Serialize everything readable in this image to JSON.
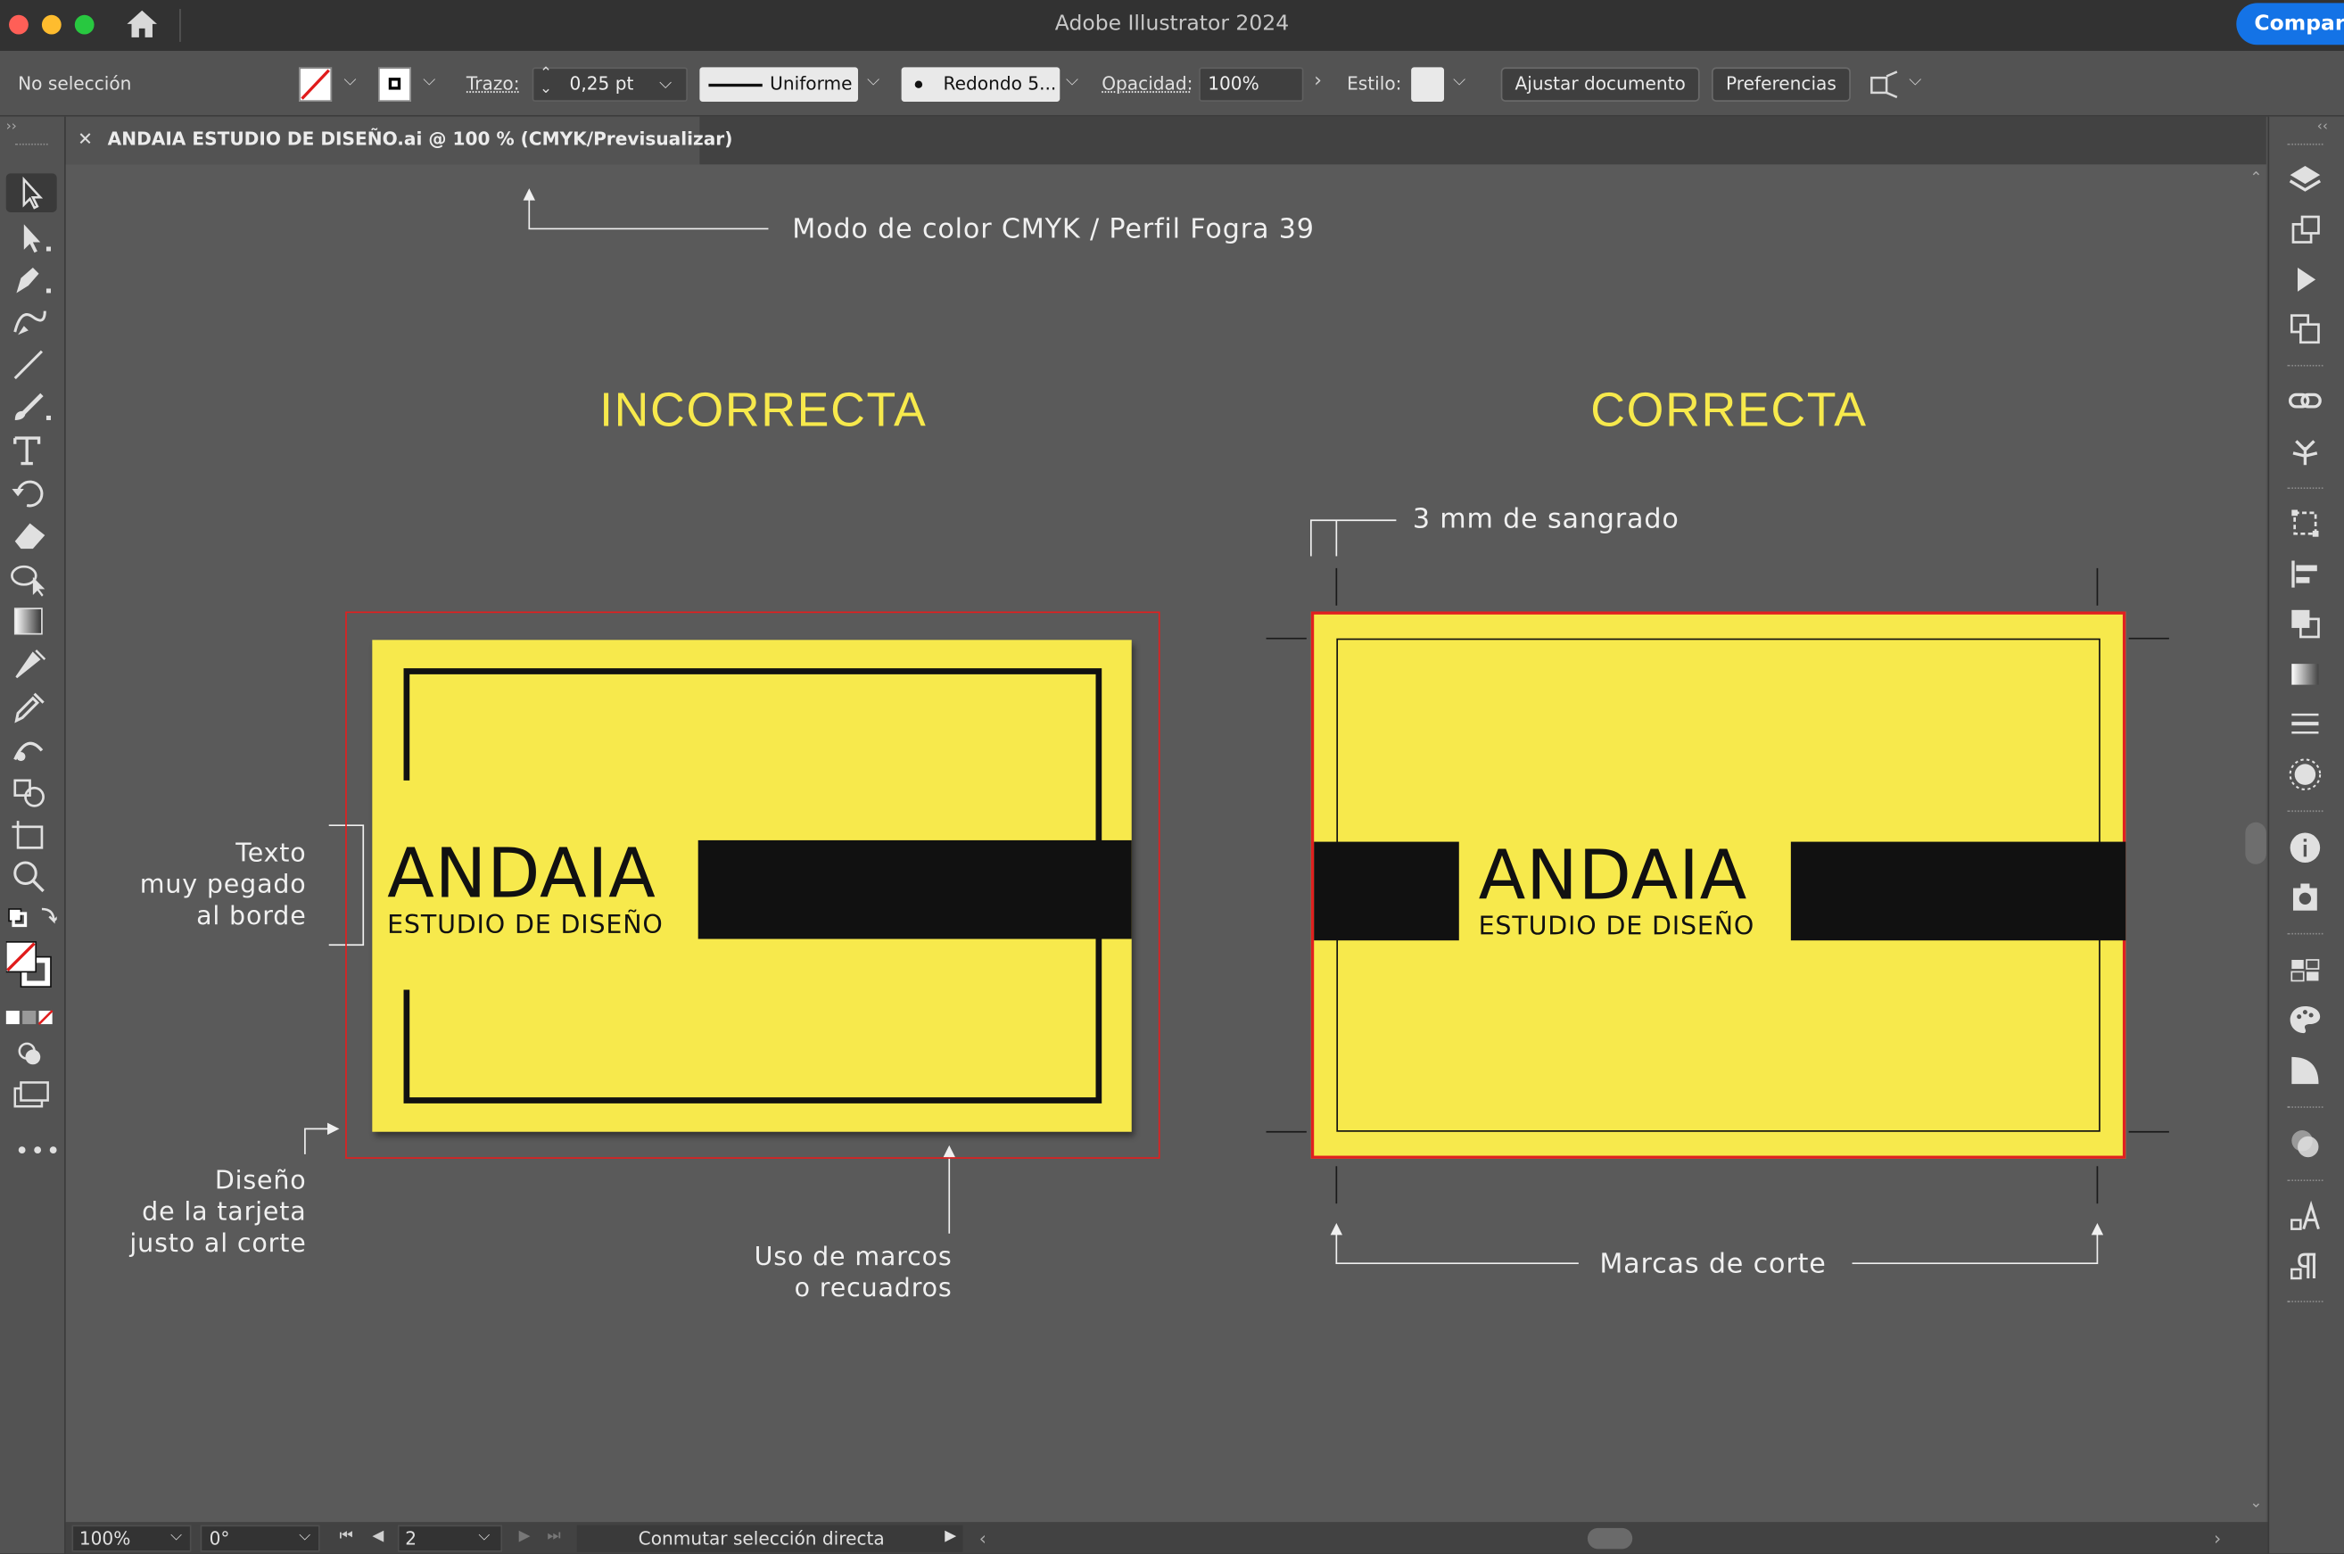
{
  "window": {
    "app_title": "Adobe Illustrator 2024",
    "share_label": "Compart"
  },
  "control_bar": {
    "selection_status": "No selección",
    "stroke_label": "Trazo:",
    "stroke_value": "0,25 pt",
    "profile_value": "Uniforme",
    "brush_value": "Redondo 5...",
    "opacity_label": "Opacidad:",
    "opacity_value": "100%",
    "style_label": "Estilo:",
    "adjust_document_label": "Ajustar documento",
    "preferences_label": "Preferencias"
  },
  "document": {
    "tab_title": "ANDAIA ESTUDIO DE DISEÑO.ai @ 100 % (CMYK/Previsualizar)"
  },
  "artwork": {
    "color_mode_note": "Modo de color CMYK / Perfil Fogra 39",
    "left_heading": "INCORRECTA",
    "right_heading": "CORRECTA",
    "bleed_note": "3 mm de sangrado",
    "brand_name": "ANDAIA",
    "brand_subtitle": "ESTUDIO DE DISEÑO",
    "note_text_edge": [
      "Texto",
      "muy pegado",
      "al borde"
    ],
    "note_cut_edge": [
      "Diseño",
      "de la tarjeta",
      "justo al corte"
    ],
    "note_frames": [
      "Uso de marcos",
      "o recuadros"
    ],
    "note_crop_marks": "Marcas de corte",
    "card_color": "#f7e94c",
    "bleed_color": "#e02020"
  },
  "status_bar": {
    "zoom_value": "100%",
    "rotation_value": "0°",
    "artboard_value": "2",
    "status_text": "Conmutar selección directa"
  }
}
